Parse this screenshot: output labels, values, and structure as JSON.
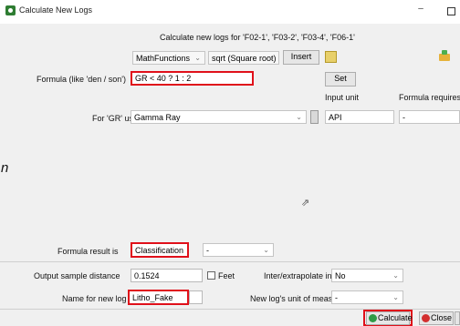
{
  "window": {
    "title": "Calculate New Logs",
    "minimize": "–"
  },
  "header": "Calculate new logs for 'F02-1', 'F03-2', 'F03-4', 'F06-1'",
  "toolbar": {
    "functions": "MathFunctions",
    "function": "sqrt (Square root)",
    "insert": "Insert",
    "set": "Set"
  },
  "formula": {
    "label": "Formula (like 'den / son')",
    "value": "GR < 40 ? 1 : 2"
  },
  "columns": {
    "input_unit": "Input unit",
    "formula_requires": "Formula requires"
  },
  "variable": {
    "label": "For 'GR' use",
    "log": "Gamma Ray",
    "unit": "API",
    "requires": "-"
  },
  "side_letter": "n",
  "result": {
    "label": "Formula result is",
    "type": "Classification",
    "subtype": "-"
  },
  "sampling": {
    "label": "Output sample distance",
    "value": "0.1524",
    "feet_label": "Feet",
    "interp_label": "Inter/extrapolate input logs?",
    "interp_value": "No"
  },
  "naming": {
    "label": "Name for new log",
    "value": "Litho_Fake",
    "unit_label": "New log's unit of measure",
    "unit_value": "-"
  },
  "buttons": {
    "calculate": "Calculate",
    "close": "Close"
  },
  "colors": {
    "highlight": "#e0101a",
    "calc_icon": "#2e9b46",
    "close_icon": "#d32f2f"
  }
}
